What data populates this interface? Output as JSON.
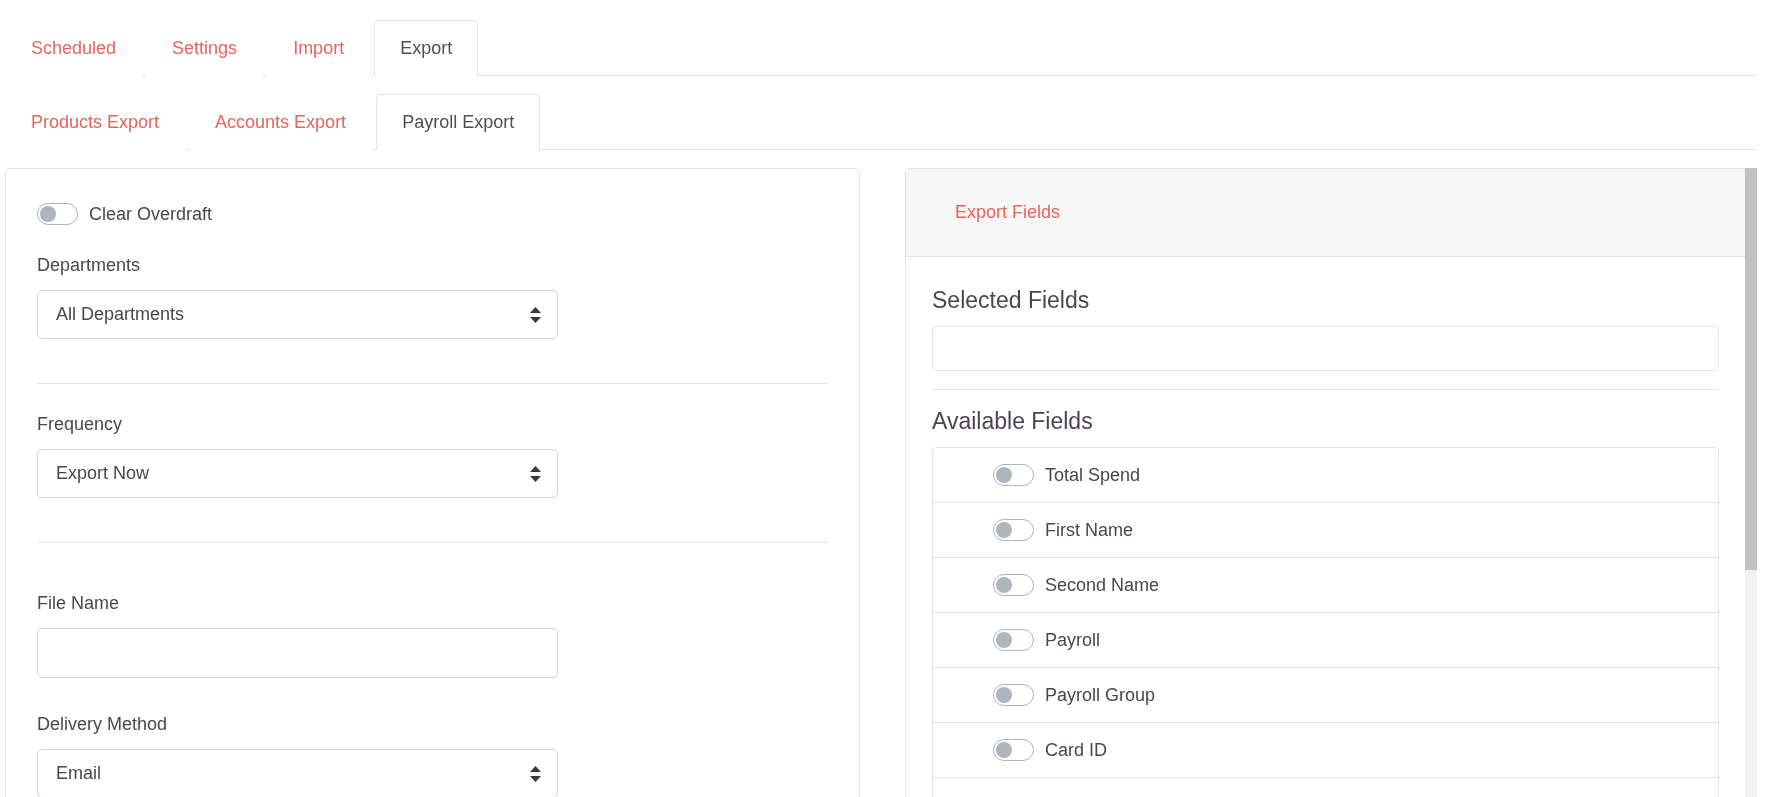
{
  "main_tabs": [
    {
      "label": "Scheduled",
      "selected": false
    },
    {
      "label": "Settings",
      "selected": false
    },
    {
      "label": "Import",
      "selected": false
    },
    {
      "label": "Export",
      "selected": true
    }
  ],
  "sub_tabs": [
    {
      "label": "Products Export",
      "selected": false
    },
    {
      "label": "Accounts Export",
      "selected": false
    },
    {
      "label": "Payroll Export",
      "selected": true
    }
  ],
  "form": {
    "clear_overdraft": {
      "label": "Clear Overdraft",
      "on": false
    },
    "sections": [
      {
        "kind": "select",
        "label": "Departments",
        "value": "All Departments"
      },
      {
        "kind": "divider"
      },
      {
        "kind": "select",
        "label": "Frequency",
        "value": "Export Now"
      },
      {
        "kind": "divider"
      },
      {
        "kind": "input",
        "label": "File Name"
      },
      {
        "kind": "select",
        "label": "Delivery Method",
        "value": "Email"
      }
    ]
  },
  "export_fields": {
    "title": "Export Fields",
    "selected_heading": "Selected Fields",
    "available_heading": "Available Fields",
    "available": [
      {
        "label": "Total Spend",
        "on": false
      },
      {
        "label": "First Name",
        "on": false
      },
      {
        "label": "Second Name",
        "on": false
      },
      {
        "label": "Payroll",
        "on": false
      },
      {
        "label": "Payroll Group",
        "on": false
      },
      {
        "label": "Card ID",
        "on": false
      }
    ]
  }
}
